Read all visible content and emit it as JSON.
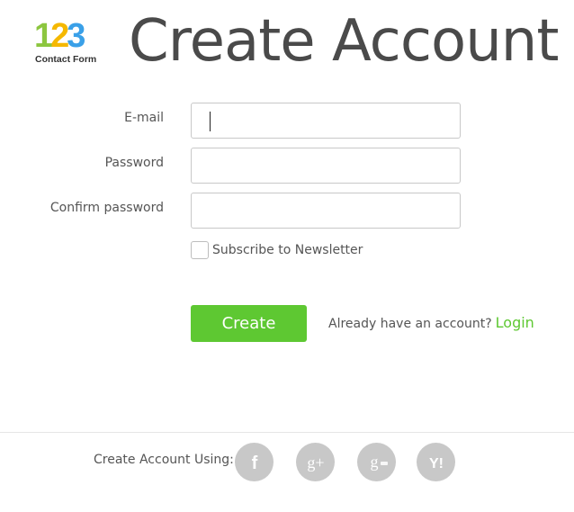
{
  "logo": {
    "digits": [
      "1",
      "2",
      "3"
    ],
    "subtitle": "Contact Form"
  },
  "page_title": "Create Account",
  "form": {
    "email_label": "E-mail",
    "email_value": "",
    "password_label": "Password",
    "password_value": "",
    "confirm_label": "Confirm password",
    "confirm_value": "",
    "newsletter_label": "Subscribe to Newsletter",
    "newsletter_checked": false,
    "create_label": "Create",
    "login_prompt": "Already have an account?",
    "login_link": "Login"
  },
  "footer": {
    "label": "Create Account Using:",
    "providers": [
      {
        "name": "facebook",
        "icon": "facebook-icon",
        "glyph": "f"
      },
      {
        "name": "google-plus",
        "icon": "google-plus-icon",
        "glyph": "g+"
      },
      {
        "name": "google-apps",
        "icon": "google-apps-icon",
        "glyph": "g"
      },
      {
        "name": "yahoo",
        "icon": "yahoo-icon",
        "glyph": "Y!"
      }
    ]
  },
  "colors": {
    "accent_green": "#5ec832",
    "social_gray": "#c8c8c8",
    "logo_1": "#8cc63f",
    "logo_2": "#f5b800",
    "logo_3": "#3aa0e8"
  }
}
